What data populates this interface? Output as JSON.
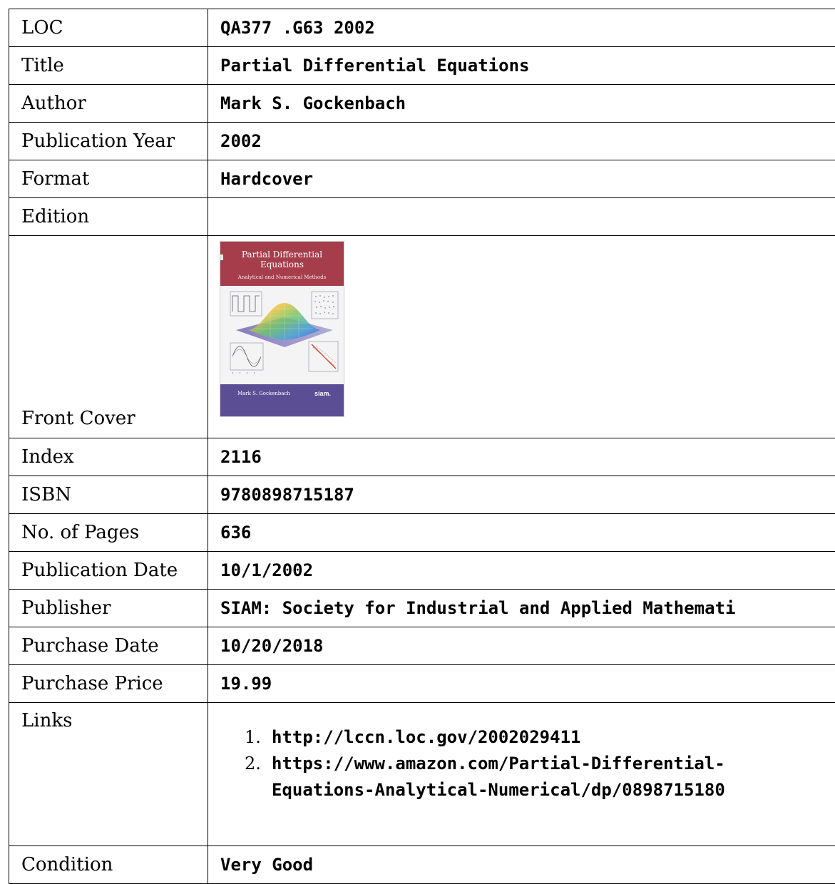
{
  "rows": {
    "loc": {
      "label": "LOC",
      "value": "QA377 .G63 2002"
    },
    "title": {
      "label": "Title",
      "value": "Partial Differential Equations"
    },
    "author": {
      "label": "Author",
      "value": "Mark S. Gockenbach"
    },
    "publication_year": {
      "label": "Publication Year",
      "value": "2002"
    },
    "format": {
      "label": "Format",
      "value": "Hardcover"
    },
    "edition": {
      "label": "Edition",
      "value": ""
    },
    "front_cover": {
      "label": "Front Cover"
    },
    "index": {
      "label": "Index",
      "value": "2116"
    },
    "isbn": {
      "label": "ISBN",
      "value": "9780898715187"
    },
    "pages": {
      "label": "No. of Pages",
      "value": "636"
    },
    "publication_date": {
      "label": "Publication Date",
      "value": "10/1/2002"
    },
    "publisher": {
      "label": "Publisher",
      "value": "SIAM: Society for Industrial and Applied Mathemati"
    },
    "purchase_date": {
      "label": "Purchase Date",
      "value": "10/20/2018"
    },
    "purchase_price": {
      "label": "Purchase Price",
      "value": "19.99"
    },
    "links": {
      "label": "Links",
      "items": [
        {
          "text": "http://lccn.loc.gov/2002029411"
        },
        {
          "line1": "https://www.amazon.com/Partial-Differential-",
          "line2": "Equations-Analytical-Numerical/dp/0898715180"
        }
      ]
    },
    "condition": {
      "label": "Condition",
      "value": "Very Good"
    }
  },
  "cover": {
    "title_line1": "Partial Differential",
    "title_line2": "Equations",
    "subtitle": "Analytical and Numerical Methods",
    "author": "Mark S. Gockenbach",
    "publisher_logo": "siam.",
    "colors": {
      "top_band": "#a53e4a",
      "bottom_band": "#5b4e95",
      "background": "#f4f4f5"
    }
  }
}
